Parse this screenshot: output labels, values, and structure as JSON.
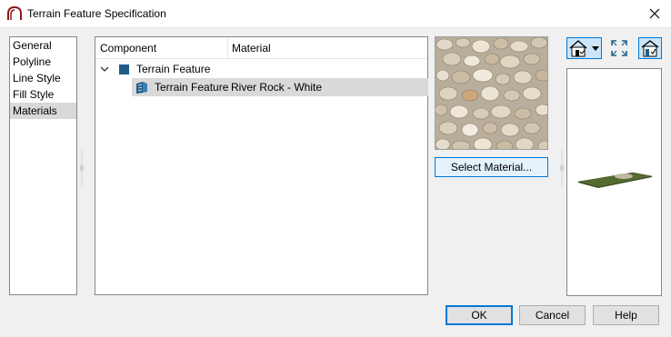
{
  "window": {
    "title": "Terrain Feature Specification"
  },
  "nav": {
    "items": [
      {
        "label": "General",
        "selected": false
      },
      {
        "label": "Polyline",
        "selected": false
      },
      {
        "label": "Line Style",
        "selected": false
      },
      {
        "label": "Fill Style",
        "selected": false
      },
      {
        "label": "Materials",
        "selected": true
      }
    ]
  },
  "materials": {
    "columns": [
      "Component",
      "Material"
    ],
    "group": {
      "label": "Terrain Feature",
      "expanded": true
    },
    "rows": [
      {
        "component": "Terrain Feature",
        "material": "River Rock - White",
        "selected": true
      }
    ]
  },
  "swatch": {
    "select_label": "Select Material..."
  },
  "preview_toolbar": {
    "view_icon": "house-view-dropdown-icon",
    "fit_icon": "fit-view-icon",
    "toggle_icon": "house-check-icon"
  },
  "buttons": {
    "ok": "OK",
    "cancel": "Cancel",
    "help": "Help"
  },
  "colors": {
    "accent": "#0078d7",
    "tree_folder": "#1f5d86",
    "selection": "#d9d9d9",
    "terrain_preview": "#556b2f"
  }
}
